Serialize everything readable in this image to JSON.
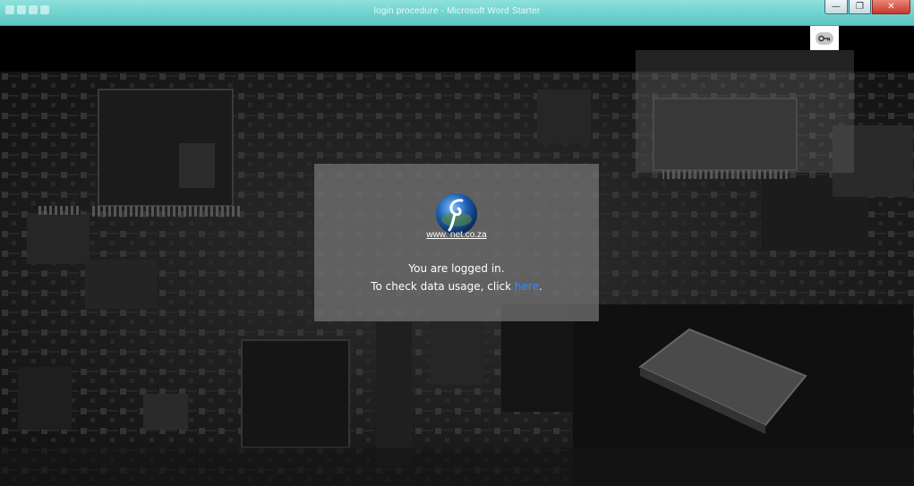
{
  "window": {
    "title": "login procedure - Microsoft Word Starter",
    "minimize_glyph": "—",
    "maximize_glyph": "❐",
    "close_glyph": "✕"
  },
  "header": {
    "key_icon": "key-icon"
  },
  "panel": {
    "logo_icon": "gnet-logo-icon",
    "site_link": "www.   net.co.za",
    "logged_in_text": "You are logged in.",
    "check_text": "To check data usage, click ",
    "here_link": "here",
    "period": "."
  },
  "colors": {
    "link_blue": "#2f8fff",
    "titlebar": "#6fd2ce",
    "panel": "#767676"
  }
}
